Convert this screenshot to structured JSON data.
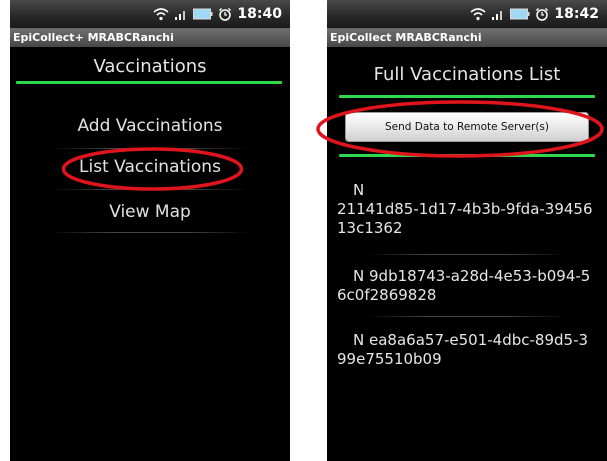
{
  "left_screen": {
    "status_bar": {
      "time": "18:40"
    },
    "app_title": "EpiCollect+ MRABCRanchi",
    "heading": "Vaccinations",
    "menu_items": [
      {
        "label": "Add Vaccinations"
      },
      {
        "label": "List Vaccinations",
        "highlighted": true
      },
      {
        "label": "View Map"
      }
    ]
  },
  "right_screen": {
    "status_bar": {
      "time": "18:42"
    },
    "app_title": "EpiCollect MRABCRanchi",
    "heading": "Full Vaccinations List",
    "send_button_label": "Send Data to Remote Server(s)",
    "records": [
      {
        "prefix": "N",
        "id": "21141d85-1d17-4b3b-9fda-3945613c1362"
      },
      {
        "prefix": "N",
        "id": "9db18743-a28d-4e53-b094-56c0f2869828"
      },
      {
        "prefix": "N",
        "id": "ea8a6a57-e501-4dbc-89d5-399e75510b09"
      }
    ]
  },
  "icons": [
    "wifi-icon",
    "signal-icon",
    "battery-icon",
    "alarm-clock-icon"
  ],
  "colors": {
    "accent_line": "#2fd84a",
    "annotation_ellipse": "#e0141c",
    "screen_background": "#000000"
  }
}
